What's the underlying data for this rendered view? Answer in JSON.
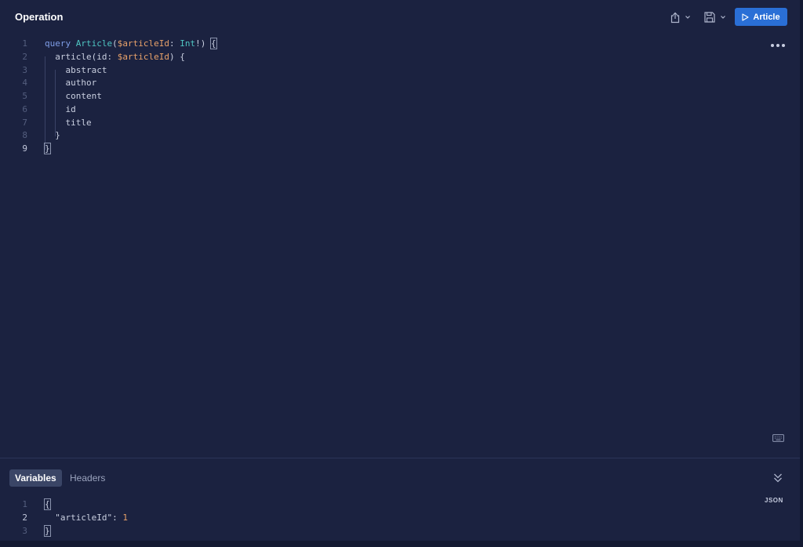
{
  "header": {
    "title": "Operation",
    "run_label": "Article"
  },
  "operation_editor": {
    "lines": [
      {
        "number": "1",
        "tokens": [
          {
            "t": "query",
            "c": "kw"
          },
          {
            "t": " ",
            "c": ""
          },
          {
            "t": "Article",
            "c": "tp"
          },
          {
            "t": "(",
            "c": ""
          },
          {
            "t": "$articleId",
            "c": "var"
          },
          {
            "t": ": ",
            "c": ""
          },
          {
            "t": "Int",
            "c": "tp"
          },
          {
            "t": "!) ",
            "c": ""
          },
          {
            "t": "{",
            "c": "bm"
          }
        ]
      },
      {
        "number": "2",
        "tokens": [
          {
            "t": "  article(id: ",
            "c": ""
          },
          {
            "t": "$articleId",
            "c": "var"
          },
          {
            "t": ") {",
            "c": ""
          }
        ]
      },
      {
        "number": "3",
        "tokens": [
          {
            "t": "    abstract",
            "c": ""
          }
        ]
      },
      {
        "number": "4",
        "tokens": [
          {
            "t": "    author",
            "c": ""
          }
        ]
      },
      {
        "number": "5",
        "tokens": [
          {
            "t": "    content",
            "c": ""
          }
        ]
      },
      {
        "number": "6",
        "tokens": [
          {
            "t": "    id",
            "c": ""
          }
        ]
      },
      {
        "number": "7",
        "tokens": [
          {
            "t": "    title",
            "c": ""
          }
        ]
      },
      {
        "number": "8",
        "tokens": [
          {
            "t": "  }",
            "c": ""
          }
        ]
      },
      {
        "number": "9",
        "tokens": [
          {
            "t": "}",
            "c": "bm"
          }
        ]
      }
    ],
    "active_line": "9"
  },
  "tabs": {
    "variables_label": "Variables",
    "headers_label": "Headers",
    "active": "Variables"
  },
  "variables_editor": {
    "format_label": "JSON",
    "lines": [
      {
        "number": "1",
        "tokens": [
          {
            "t": "{",
            "c": "bm"
          }
        ]
      },
      {
        "number": "2",
        "tokens": [
          {
            "t": "  \"articleId\"",
            "c": "str"
          },
          {
            "t": ": ",
            "c": ""
          },
          {
            "t": "1",
            "c": "num"
          }
        ]
      },
      {
        "number": "3",
        "tokens": [
          {
            "t": "}",
            "c": "bm"
          }
        ]
      }
    ],
    "active_line": "2"
  },
  "icons": {
    "share": "share-icon",
    "save": "save-icon",
    "chevron": "chevron-down-icon",
    "run": "play-icon",
    "more": "more-horizontal-icon",
    "keyboard": "keyboard-icon",
    "collapse": "double-chevron-down-icon"
  },
  "colors": {
    "background": "#1b2240",
    "accent": "#2a6fd6",
    "keyword": "#7f9ee8",
    "type": "#4fc6c2",
    "variable": "#e8a26a"
  }
}
